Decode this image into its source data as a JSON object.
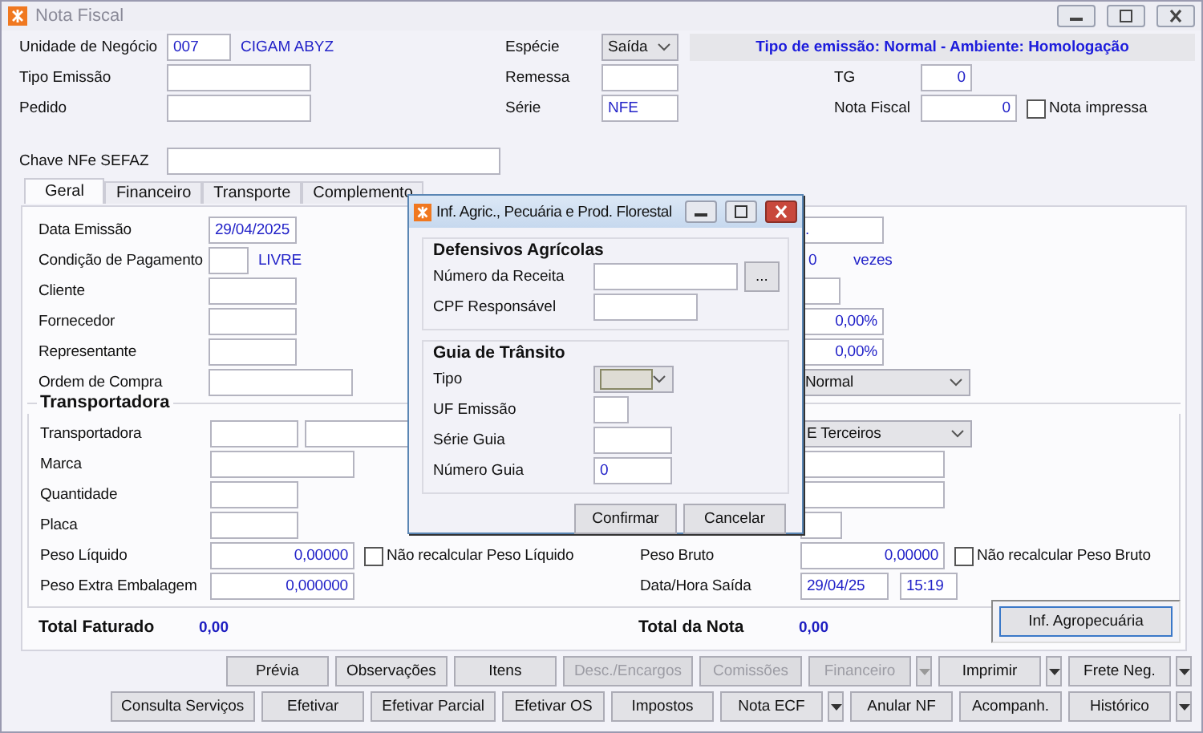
{
  "window": {
    "title": "Nota Fiscal",
    "active": false
  },
  "header": {
    "unidade_negocio": {
      "label": "Unidade de Negócio",
      "code": "007",
      "name": "CIGAM ABYZ"
    },
    "especie": {
      "label": "Espécie",
      "value": "Saída"
    },
    "banner": "Tipo de emissão: Normal - Ambiente: Homologação",
    "tipo_emissao": {
      "label": "Tipo Emissão"
    },
    "remessa": {
      "label": "Remessa"
    },
    "tg": {
      "label": "TG",
      "value": "0"
    },
    "pedido": {
      "label": "Pedido"
    },
    "serie": {
      "label": "Série",
      "value": "NFE"
    },
    "nota_fiscal": {
      "label": "Nota Fiscal",
      "value": "0"
    },
    "nota_impressa": {
      "label": "Nota impressa",
      "checked": false
    },
    "chave": {
      "label": "Chave NFe SEFAZ"
    }
  },
  "tabs": [
    {
      "label": "Geral",
      "selected": true
    },
    {
      "label": "Financeiro",
      "selected": false
    },
    {
      "label": "Transporte",
      "selected": false
    },
    {
      "label": "Complemento",
      "selected": false
    }
  ],
  "geral": {
    "rows": [
      {
        "left": {
          "label": "Data Emissão",
          "kind": "field",
          "value": "29/04/2025"
        },
        "right": {
          "kind": "field",
          "value": "."
        }
      },
      {
        "left": {
          "label": "Condição de Pagamento",
          "kind": "code",
          "name": "LIVRE"
        },
        "right": {
          "kind": "count",
          "value": "0",
          "suffix": "vezes"
        }
      },
      {
        "left": {
          "label": "Cliente",
          "kind": "field"
        },
        "right": {
          "kind": "small"
        }
      },
      {
        "left": {
          "label": "Fornecedor",
          "kind": "field"
        },
        "right": {
          "kind": "percent",
          "value": "0,00%"
        }
      },
      {
        "left": {
          "label": "Representante",
          "kind": "field"
        },
        "right": {
          "kind": "percent",
          "value": "0,00%"
        }
      },
      {
        "left": {
          "label": "Ordem de Compra",
          "kind": "wide"
        },
        "right": {
          "kind": "combo",
          "value": "Normal"
        }
      }
    ],
    "transportadora": {
      "title": "Transportadora",
      "rows": [
        {
          "left": {
            "label": "Transportadora",
            "kind": "pair"
          },
          "right": {
            "kind": "combo",
            "value": "E Terceiros"
          }
        },
        {
          "left": {
            "label": "Marca",
            "kind": "wide"
          },
          "right": {
            "kind": "wide"
          }
        },
        {
          "left": {
            "label": "Quantidade",
            "kind": "field"
          },
          "right": {
            "kind": "wide"
          }
        },
        {
          "left": {
            "label": "Placa",
            "kind": "field"
          },
          "right": {
            "kind": "small"
          }
        },
        {
          "left": {
            "label": "Peso Líquido",
            "kind": "number",
            "value": "0,00000",
            "check": {
              "label": "Não recalcular Peso Líquido",
              "checked": false
            }
          },
          "right": {
            "label": "Peso Bruto",
            "kind": "number",
            "value": "0,00000",
            "check": {
              "label": "Não recalcular Peso Bruto",
              "checked": false
            }
          }
        },
        {
          "left": {
            "label": "Peso Extra Embalagem",
            "kind": "number",
            "value": "0,000000"
          },
          "right": {
            "label": "Data/Hora Saída",
            "kind": "datetime",
            "value": "29/04/25",
            "time": "15:19"
          }
        }
      ]
    },
    "totals": [
      {
        "label": "Total Faturado",
        "value": "0,00"
      },
      {
        "label": "Total da Nota",
        "value": "0,00"
      }
    ],
    "agro_button": "Inf. Agropecuária"
  },
  "dialog": {
    "title": "Inf. Agric., Pecuária e Prod. Florestal",
    "groups": [
      {
        "title": "Defensivos Agrícolas",
        "rows": [
          {
            "label": "Número da Receita",
            "kind": "lookup",
            "button": "..."
          },
          {
            "label": "CPF Responsável",
            "kind": "field"
          }
        ]
      },
      {
        "title": "Guia de Trânsito",
        "rows": [
          {
            "label": "Tipo",
            "kind": "combo"
          },
          {
            "label": "UF Emissão",
            "kind": "small"
          },
          {
            "label": "Série Guia",
            "kind": "field"
          },
          {
            "label": "Número Guia",
            "kind": "field",
            "value": "0"
          }
        ]
      }
    ],
    "buttons": [
      "Confirmar",
      "Cancelar"
    ]
  },
  "buttons": [
    [
      {
        "label": "Prévia",
        "disabled": false,
        "dropdown": false
      },
      {
        "label": "Observações",
        "disabled": false,
        "dropdown": false
      },
      {
        "label": "Itens",
        "disabled": false,
        "dropdown": false
      },
      {
        "label": "Desc./Encargos",
        "disabled": true,
        "dropdown": false
      },
      {
        "label": "Comissões",
        "disabled": true,
        "dropdown": false
      },
      {
        "label": "Financeiro",
        "disabled": true,
        "dropdown": true
      },
      {
        "label": "Imprimir",
        "disabled": false,
        "dropdown": true
      },
      {
        "label": "Frete Neg.",
        "disabled": false,
        "dropdown": true
      }
    ],
    [
      {
        "label": "Consulta Serviços",
        "disabled": false,
        "dropdown": false
      },
      {
        "label": "Efetivar",
        "disabled": false,
        "dropdown": false
      },
      {
        "label": "Efetivar Parcial",
        "disabled": false,
        "dropdown": false
      },
      {
        "label": "Efetivar OS",
        "disabled": false,
        "dropdown": false
      },
      {
        "label": "Impostos",
        "disabled": false,
        "dropdown": false
      },
      {
        "label": "Nota ECF",
        "disabled": false,
        "dropdown": true
      },
      {
        "label": "Anular NF",
        "disabled": false,
        "dropdown": false
      },
      {
        "label": "Acompanh.",
        "disabled": false,
        "dropdown": false
      },
      {
        "label": "Histórico",
        "disabled": false,
        "dropdown": true
      }
    ]
  ]
}
